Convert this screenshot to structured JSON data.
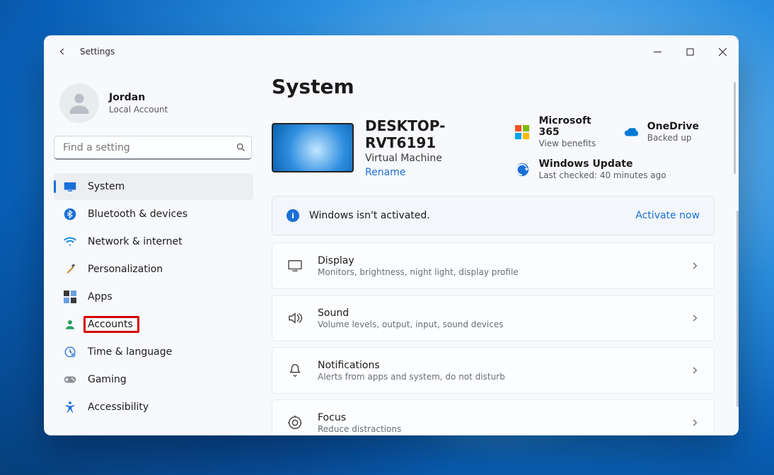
{
  "window": {
    "app_title": "Settings"
  },
  "user": {
    "name": "Jordan",
    "subtitle": "Local Account"
  },
  "search": {
    "placeholder": "Find a setting"
  },
  "nav": {
    "items": [
      {
        "label": "System",
        "icon": "monitor-icon",
        "active": true
      },
      {
        "label": "Bluetooth & devices",
        "icon": "bluetooth-icon",
        "active": false
      },
      {
        "label": "Network & internet",
        "icon": "wifi-icon",
        "active": false
      },
      {
        "label": "Personalization",
        "icon": "brush-icon",
        "active": false
      },
      {
        "label": "Apps",
        "icon": "apps-icon",
        "active": false
      },
      {
        "label": "Accounts",
        "icon": "person-icon",
        "active": false,
        "highlighted": true
      },
      {
        "label": "Time & language",
        "icon": "clock-icon",
        "active": false
      },
      {
        "label": "Gaming",
        "icon": "gamepad-icon",
        "active": false
      },
      {
        "label": "Accessibility",
        "icon": "accessibility-icon",
        "active": false
      }
    ]
  },
  "page": {
    "title": "System",
    "device": {
      "name": "DESKTOP-RVT6191",
      "type": "Virtual Machine",
      "rename_label": "Rename"
    },
    "tiles": {
      "ms365": {
        "title": "Microsoft 365",
        "subtitle": "View benefits"
      },
      "onedrive": {
        "title": "OneDrive",
        "subtitle": "Backed up"
      },
      "winupd": {
        "title": "Windows Update",
        "subtitle": "Last checked: 40 minutes ago"
      }
    },
    "banner": {
      "text": "Windows isn't activated.",
      "action": "Activate now"
    },
    "cards": [
      {
        "title": "Display",
        "subtitle": "Monitors, brightness, night light, display profile",
        "icon": "display-icon"
      },
      {
        "title": "Sound",
        "subtitle": "Volume levels, output, input, sound devices",
        "icon": "sound-icon"
      },
      {
        "title": "Notifications",
        "subtitle": "Alerts from apps and system, do not disturb",
        "icon": "bell-icon"
      },
      {
        "title": "Focus",
        "subtitle": "Reduce distractions",
        "icon": "focus-icon"
      }
    ]
  }
}
